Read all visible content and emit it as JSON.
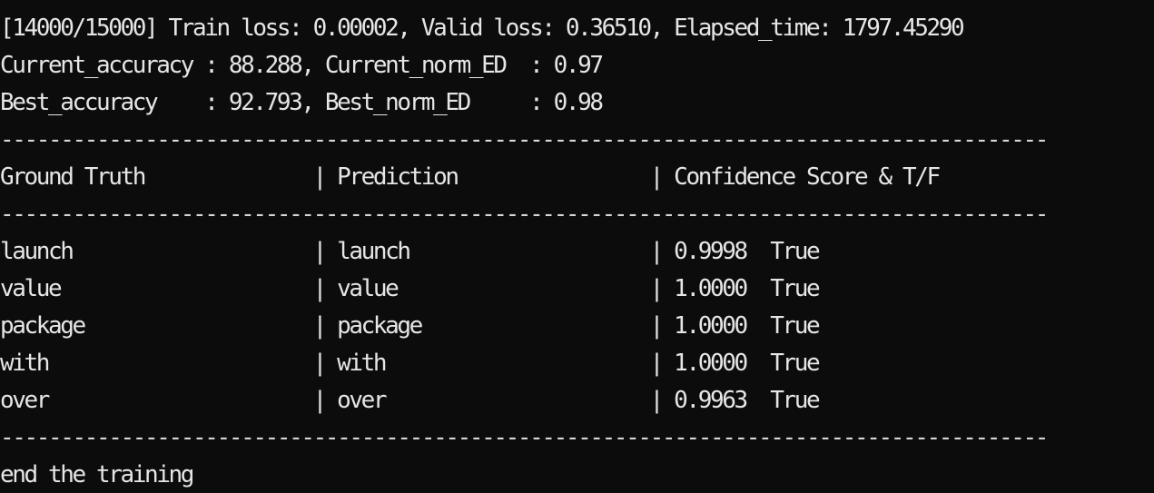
{
  "terminal": {
    "status_line": "[14000/15000] Train loss: 0.00002, Valid loss: 0.36510, Elapsed_time: 1797.45290",
    "current_line": "Current_accuracy : 88.288, Current_norm_ED  : 0.97",
    "best_line": "Best_accuracy    : 92.793, Best_norm_ED     : 0.98",
    "separator": "---------------------------------------------------------------------------------------",
    "table": {
      "header": "Ground Truth              | Prediction                | Confidence Score & T/F",
      "rows": [
        "launch                    | launch                    | 0.9998  True",
        "value                     | value                     | 1.0000  True",
        "package                   | package                   | 1.0000  True",
        "with                      | with                      | 1.0000  True",
        "over                      | over                      | 0.9963  True"
      ]
    },
    "final_line": "end the training"
  }
}
